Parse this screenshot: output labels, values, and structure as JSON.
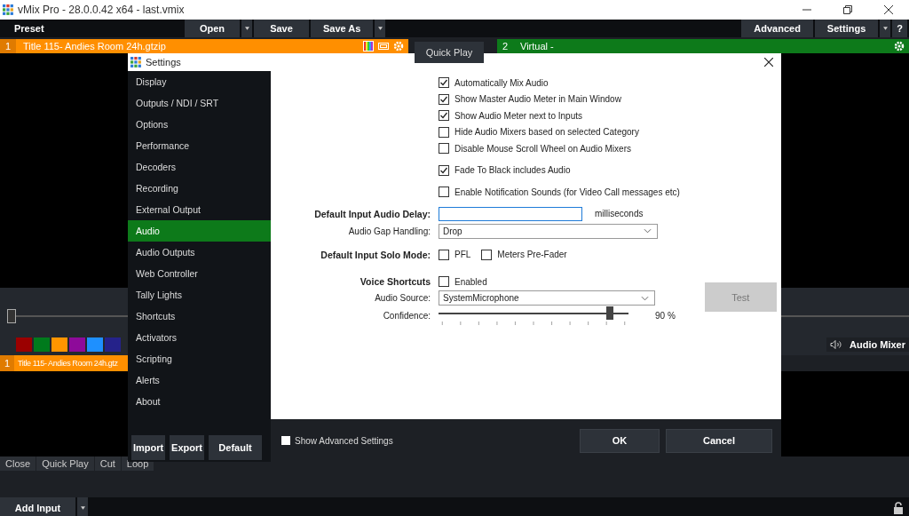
{
  "window": {
    "title": "vMix Pro - 28.0.0.42 x64 - last.vmix"
  },
  "toolbar": {
    "preset": "Preset",
    "left_buttons": [
      {
        "label": "Open",
        "dropdown": true
      },
      {
        "label": "Save",
        "dropdown": false
      },
      {
        "label": "Save As",
        "dropdown": true
      }
    ],
    "right_buttons": [
      {
        "label": "Advanced",
        "dropdown": false
      },
      {
        "label": "Settings",
        "dropdown": true
      }
    ],
    "help": "?"
  },
  "preview": {
    "number": "1",
    "title": "Title 115- Andies Room 24h.gtzip"
  },
  "quick_play": "Quick Play",
  "transition": {
    "level": 0
  },
  "output": {
    "number": "2",
    "title": "Virtual -"
  },
  "color_swatches": [
    {
      "color": "#9b0000"
    },
    {
      "color": "#007a1c"
    },
    {
      "color": "#ff9500"
    },
    {
      "color": "#8e0a9a"
    },
    {
      "color": "#1e90ff"
    },
    {
      "color": "#25228a"
    }
  ],
  "input": {
    "number": "1",
    "title": "Title 115- Andies Room 24h.gtz"
  },
  "input_buttons": [
    "Close",
    "Quick Play",
    "Cut",
    "Loop"
  ],
  "audio_mixer": "Audio Mixer",
  "add_input": "Add Input",
  "settings": {
    "title": "Settings",
    "categories": [
      {
        "label": "Display",
        "selected": false
      },
      {
        "label": "Outputs / NDI / SRT",
        "selected": false
      },
      {
        "label": "Options",
        "selected": false
      },
      {
        "label": "Performance",
        "selected": false
      },
      {
        "label": "Decoders",
        "selected": false
      },
      {
        "label": "Recording",
        "selected": false
      },
      {
        "label": "External Output",
        "selected": false
      },
      {
        "label": "Audio",
        "selected": true
      },
      {
        "label": "Audio Outputs",
        "selected": false
      },
      {
        "label": "Web Controller",
        "selected": false
      },
      {
        "label": "Tally Lights",
        "selected": false
      },
      {
        "label": "Shortcuts",
        "selected": false
      },
      {
        "label": "Activators",
        "selected": false
      },
      {
        "label": "Scripting",
        "selected": false
      },
      {
        "label": "Alerts",
        "selected": false
      },
      {
        "label": "About",
        "selected": false
      }
    ],
    "sidebar_buttons": [
      "Import",
      "Export",
      "Default"
    ],
    "option_groups": [
      [
        {
          "label": "Automatically Mix Audio",
          "checked": true
        },
        {
          "label": "Show Master Audio Meter in Main Window",
          "checked": true
        },
        {
          "label": "Show Audio Meter next to Inputs",
          "checked": true
        },
        {
          "label": "Hide Audio Mixers based on selected Category",
          "checked": false
        },
        {
          "label": "Disable Mouse Scroll Wheel on Audio Mixers",
          "checked": false
        }
      ],
      [
        {
          "label": "Fade To Black includes Audio",
          "checked": true
        }
      ],
      [
        {
          "label": "Enable Notification Sounds (for Video Call messages etc)",
          "checked": false
        }
      ]
    ],
    "audio_delay": {
      "label": "Default Input Audio Delay:",
      "unit": "milliseconds"
    },
    "gap_handling": {
      "label": "Audio Gap Handling:",
      "value": "Drop"
    },
    "solo_mode": {
      "label": "Default Input Solo Mode:",
      "options": [
        {
          "label": "PFL",
          "checked": false
        },
        {
          "label": "Meters Pre-Fader",
          "checked": false
        }
      ]
    },
    "voice_shortcuts": {
      "label": "Voice Shortcuts",
      "enabled": {
        "label": "Enabled",
        "checked": false
      },
      "source_label": "Audio Source:",
      "source": "SystemMicrophone",
      "test": "Test",
      "confidence_label": "Confidence:",
      "confidence": {
        "level": 0.9,
        "reading": "90 %"
      }
    },
    "show_advanced": {
      "label": "Show Advanced Settings",
      "checked": false
    },
    "buttons": [
      "OK",
      "Cancel"
    ]
  }
}
